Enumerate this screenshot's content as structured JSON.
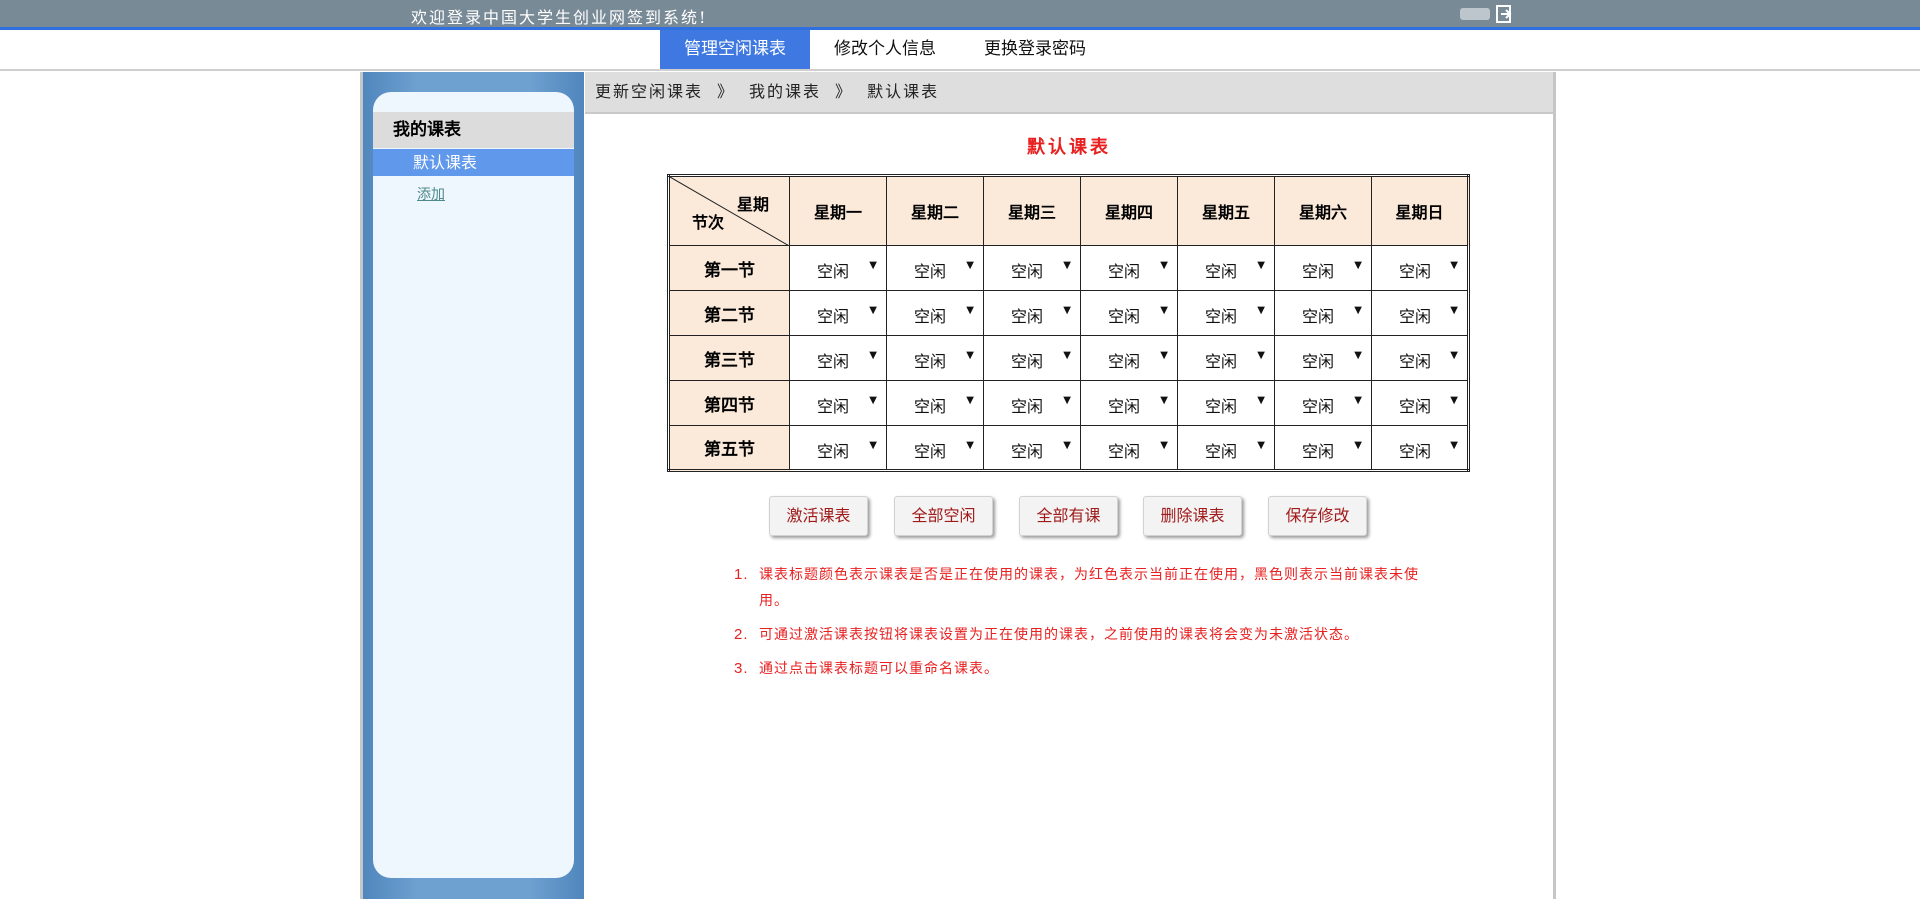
{
  "header": {
    "welcome": "欢迎登录中国大学生创业网签到系统!"
  },
  "nav": {
    "tabs": [
      "管理空闲课表",
      "修改个人信息",
      "更换登录密码"
    ],
    "active_index": 0,
    "active_color": "#3e78e0"
  },
  "sidebar": {
    "section_title": "我的课表",
    "items": [
      {
        "label": "默认课表",
        "active": true
      },
      {
        "label": "添加",
        "active": false
      }
    ]
  },
  "breadcrumb": [
    "更新空闲课表",
    "我的课表",
    "默认课表"
  ],
  "breadcrumb_separator": "》",
  "schedule": {
    "title": "默认课表",
    "title_color": "#e82020",
    "corner_top": "星期",
    "corner_bottom": "节次",
    "days": [
      "星期一",
      "星期二",
      "星期三",
      "星期四",
      "星期五",
      "星期六",
      "星期日"
    ],
    "periods": [
      "第一节",
      "第二节",
      "第三节",
      "第四节",
      "第五节"
    ],
    "cell_value": "空闲"
  },
  "buttons": [
    "激活课表",
    "全部空闲",
    "全部有课",
    "删除课表",
    "保存修改"
  ],
  "notes": [
    "课表标题颜色表示课表是否是正在使用的课表，为红色表示当前正在使用，黑色则表示当前课表未使用。",
    "可通过激活课表按钮将课表设置为正在使用的课表，之前使用的课表将会变为未激活状态。",
    "通过点击课表标题可以重命名课表。"
  ]
}
